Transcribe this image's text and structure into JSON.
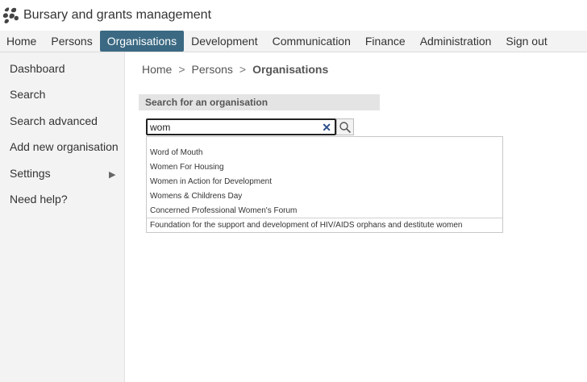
{
  "app": {
    "title": "Bursary and grants management",
    "accent_color": "#3b6983"
  },
  "nav": {
    "items": [
      {
        "label": "Home"
      },
      {
        "label": "Persons"
      },
      {
        "label": "Organisations",
        "active": true
      },
      {
        "label": "Development"
      },
      {
        "label": "Communication"
      },
      {
        "label": "Finance"
      },
      {
        "label": "Administration"
      },
      {
        "label": "Sign out"
      }
    ]
  },
  "sidebar": {
    "items": [
      {
        "label": "Dashboard"
      },
      {
        "label": "Search"
      },
      {
        "label": "Search advanced"
      },
      {
        "label": "Add new organisation"
      },
      {
        "label": "Settings",
        "icon": "triangle-right-icon"
      },
      {
        "label": "Need help?"
      }
    ]
  },
  "breadcrumb": {
    "items": [
      "Home",
      "Persons"
    ],
    "separator": ">",
    "current": "Organisations"
  },
  "search": {
    "heading": "Search for an organisation",
    "value": "wom",
    "clear_icon": "close-icon",
    "button_icon": "search-icon",
    "results": [
      "Word of Mouth",
      "Women For Housing",
      "Women in Action for Development",
      "Womens & Childrens Day",
      "Concerned Professional Women's Forum",
      "Foundation for the support and development of HIV/AIDS orphans and destitute women"
    ]
  }
}
